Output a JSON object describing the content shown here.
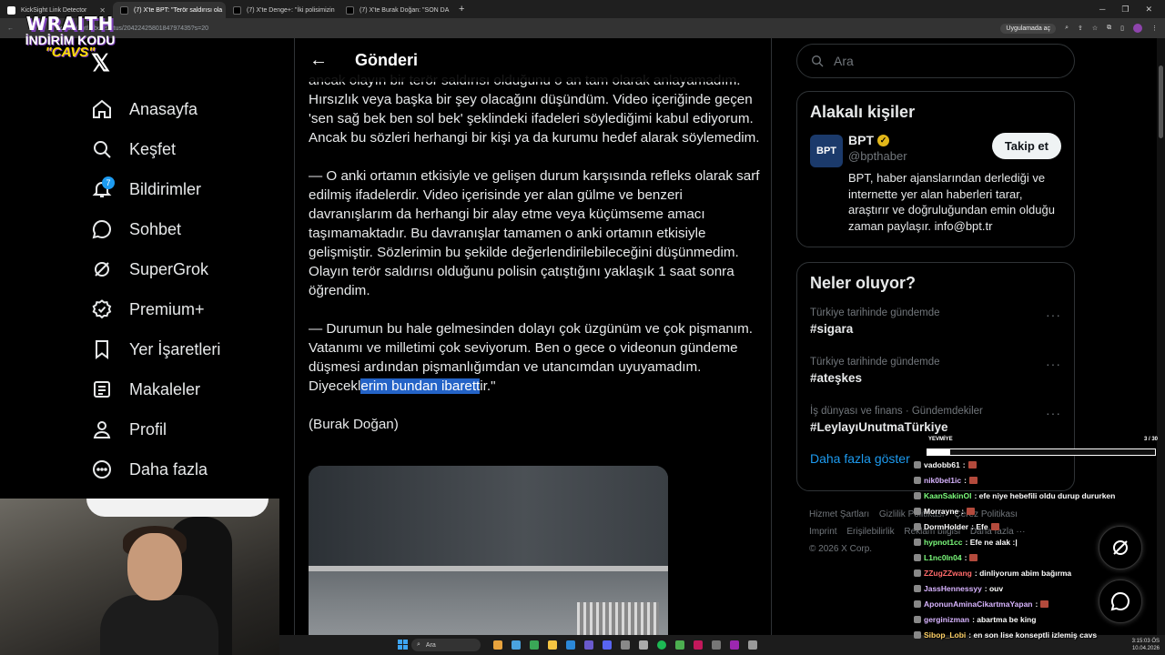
{
  "browser": {
    "tabs": [
      {
        "label": "KickSight Link Detector",
        "active": false
      },
      {
        "label": "(7) X'te BPT: \"Terör saldırısı ola",
        "active": true
      },
      {
        "label": "(7) X'te Denge+: \"İki polisimizin",
        "active": false
      },
      {
        "label": "(7) X'te Burak Doğan: \"SON DA",
        "active": false
      }
    ],
    "new_tab": "+",
    "url": "x.com/bpthaber/status/2042242580184797435?s=20",
    "open_in_app": "Uygulamada aç"
  },
  "overlay_logo": {
    "line1": "WRAITH",
    "line2": "İNDİRİM KODU",
    "line3": "\"CAVS\""
  },
  "x_logo": "𝕏",
  "nav": [
    {
      "label": "Anasayfa",
      "icon": "home-icon"
    },
    {
      "label": "Keşfet",
      "icon": "search-icon"
    },
    {
      "label": "Bildirimler",
      "icon": "bell-icon",
      "badge": "7"
    },
    {
      "label": "Sohbet",
      "icon": "chat-icon"
    },
    {
      "label": "SuperGrok",
      "icon": "grok-icon"
    },
    {
      "label": "Premium+",
      "icon": "premium-icon"
    },
    {
      "label": "Yer İşaretleri",
      "icon": "bookmark-icon"
    },
    {
      "label": "Makaleler",
      "icon": "articles-icon"
    },
    {
      "label": "Profil",
      "icon": "profile-icon"
    },
    {
      "label": "Daha fazla",
      "icon": "more-icon"
    }
  ],
  "main": {
    "back": "←",
    "title": "Gönderi",
    "para1": "ancak olayın bir terör saldırısı olduğunu o an tam olarak anlayamadım. Hırsızlık veya başka bir şey olacağını düşündüm. Video içeriğinde geçen 'sen sağ bek ben sol bek' şeklindeki ifadeleri söylediğimi kabul ediyorum. Ancak bu sözleri herhangi bir kişi ya da kurumu hedef alarak söylemedim.",
    "para2": "— O anki ortamın etkisiyle ve gelişen durum karşısında refleks olarak sarf edilmiş ifadelerdir. Video içerisinde yer alan gülme ve benzeri davranışlarım da herhangi bir alay etme veya küçümseme amacı taşımamaktadır. Bu davranışlar tamamen o anki ortamın etkisiyle gelişmiştir. Sözlerimin bu şekilde değerlendirilebileceğini düşünmedim. Olayın terör saldırısı olduğunu polisin çatıştığını yaklaşık 1 saat sonra öğrendim.",
    "para3_a": "— Durumun bu hale gelmesinden dolayı çok üzgünüm ve çok pişmanım. Vatanımı ve milletimi çok seviyorum. Ben o gece o videonun gündeme düşmesi ardından pişmanlığımdan ve utancımdan uyuyamadım. Diyecekl",
    "para3_hl": "erim bundan ibarett",
    "para3_b": "ir.\"",
    "signature": "(Burak Doğan)"
  },
  "search": {
    "placeholder": "Ara"
  },
  "related": {
    "title": "Alakalı kişiler",
    "avatar_text": "BPT",
    "name": "BPT",
    "handle": "@bpthaber",
    "bio": "BPT, haber ajanslarından derlediği ve internette yer alan haberleri tarar, araştırır ve doğruluğundan emin olduğu zaman paylaşır. info@bpt.tr",
    "follow": "Takip et"
  },
  "trends": {
    "title": "Neler oluyor?",
    "items": [
      {
        "context": "Türkiye tarihinde gündemde",
        "name": "#sigara"
      },
      {
        "context": "Türkiye tarihinde gündemde",
        "name": "#ateşkes"
      },
      {
        "context": "İş dünyası ve finans · Gündemdekiler",
        "name": "#LeylayıUnutmaTürkiye"
      }
    ],
    "more_dots": "···",
    "show_more": "Daha fazla göster"
  },
  "footer": {
    "links": [
      "Hizmet Şartları",
      "Gizlilik Politikası",
      "Çerez Politikası",
      "Imprint",
      "Erişilebilirlik",
      "Reklam bilgisi",
      "Daha fazla ···"
    ],
    "copyright": "© 2026 X Corp."
  },
  "chat": {
    "goal_label": "YEVMİYE",
    "goal_count": "3 / 30",
    "goal_fraction": 0.1,
    "messages": [
      {
        "user": "vadobb61",
        "text": ":",
        "color": "#ffffff",
        "emote": true
      },
      {
        "user": "nik0bel1ic",
        "text": ":",
        "color": "#d8b4ff",
        "emote": true
      },
      {
        "user": "KaanSakinOl",
        "text": ": efe niye hebefili oldu durup dururken",
        "color": "#7CFC7C",
        "emote": false
      },
      {
        "user": "Morrayne",
        "text": ":",
        "color": "#ffffff",
        "emote": true
      },
      {
        "user": "DormHolder",
        "text": ": Efe",
        "color": "#ffffff",
        "emote": true
      },
      {
        "user": "hypnot1cc",
        "text": ": Efe ne alak :|",
        "color": "#7CFC7C",
        "emote": false
      },
      {
        "user": "L1nc0ln04",
        "text": ":",
        "color": "#7CFC7C",
        "emote": true
      },
      {
        "user": "ZZugZZwang",
        "text": ": dinliyorum abim bağırma",
        "color": "#ff6b6b",
        "emote": false
      },
      {
        "user": "JassHennessyy",
        "text": ": ouv",
        "color": "#d8b4ff",
        "emote": false
      },
      {
        "user": "AponunAminaCikartmaYapan",
        "text": ":",
        "color": "#d8b4ff",
        "emote": true
      },
      {
        "user": "gerginizman",
        "text": ": abartma be king",
        "color": "#d8b4ff",
        "emote": false
      },
      {
        "user": "Sibop_Lobi",
        "text": ": en son lise konseptli izlemiş cavs",
        "color": "#ffd166",
        "emote": false
      }
    ]
  },
  "taskbar": {
    "search": "Ara",
    "time": "3:15:03 ÖS",
    "date": "10.04.2026"
  },
  "colors": {
    "accent": "#1d9bf0",
    "highlight": "#2463c7",
    "bg": "#000000"
  }
}
